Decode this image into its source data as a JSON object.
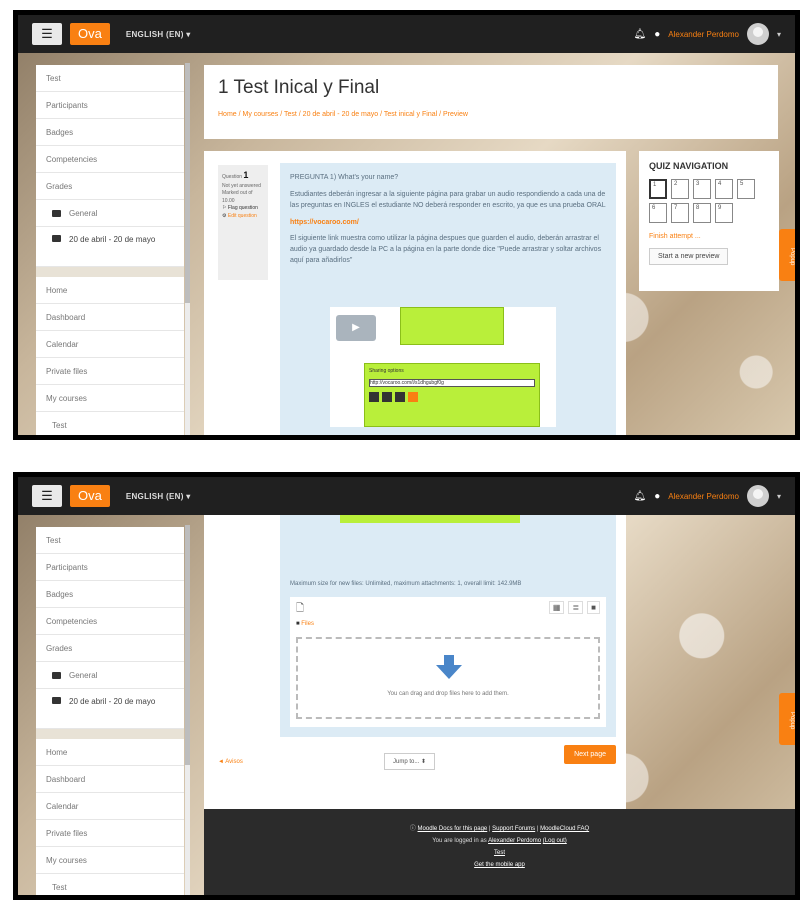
{
  "navbar": {
    "menu_icon": "hamburger-icon",
    "brand": "Ova",
    "language": "ENGLISH (EN) ▾",
    "user_name": "Alexander Perdomo",
    "caret": "▾"
  },
  "sidebar": {
    "items_top": [
      "Test",
      "Participants",
      "Badges",
      "Competencies",
      "Grades"
    ],
    "folders": [
      "General",
      "20 de abril - 20 de mayo"
    ],
    "items_bottom": [
      "Home",
      "Dashboard",
      "Calendar",
      "Private files",
      "My courses",
      "Test"
    ]
  },
  "page": {
    "title": "1 Test Inical y Final",
    "breadcrumb": "Home / My courses / Test / 20 de abril - 20 de mayo / Test inical y Final / Preview"
  },
  "question_info": {
    "label": "Question",
    "number": "1",
    "status": "Not yet answered",
    "marked": "Marked out of 10.00",
    "flag": "Flag question",
    "edit": "Edit question"
  },
  "question": {
    "prompt": "PREGUNTA 1) What's your name?",
    "instructions": "Estudiantes deberán ingresar a la siguiente página para grabar un audio respondiendo a cada una de las preguntas en INGLES el estudiante NO deberá responder en escrito, ya que es una prueba ORAL",
    "link": "https://vocaroo.com/",
    "help": "El siguiente link muestra como utilizar la página despues que guarden el audio, deberán arrastrar el audio ya guardado desde la PC a la página en la parte donde dice \"Puede arrastrar y soltar archivos aquí para añadirlos\"",
    "preview_title": "Sharing options",
    "preview_url": "http://vocaroo.com/i/s1dhgubgf0g"
  },
  "quiz_nav": {
    "title": "QUIZ NAVIGATION",
    "buttons": [
      "1",
      "2",
      "3",
      "4",
      "5",
      "6",
      "7",
      "8",
      "9"
    ],
    "finish": "Finish attempt ...",
    "start_new": "Start a new preview"
  },
  "popup_tab": "Popup",
  "filepicker": {
    "max_size": "Maximum size for new files: Unlimited, maximum attachments: 1, overall limit: 142.9MB",
    "path": "Files",
    "drop_text": "You can drag and drop files here to add them."
  },
  "navigation": {
    "previous": "◄ Avisos",
    "jump": "Jump to... ⬍",
    "next": "Next page"
  },
  "footer": {
    "docs": "Moodle Docs for this page",
    "forums": "Support Forums",
    "faq": "MoodleCloud FAQ",
    "logged_in": "You are logged in as",
    "user": "Alexander Perdomo",
    "logout": "(Log out)",
    "course": "Test",
    "app": "Get the mobile app"
  }
}
